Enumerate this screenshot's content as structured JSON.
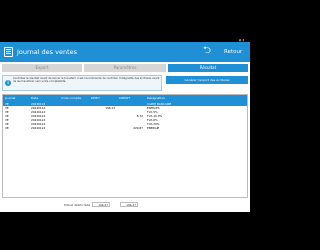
{
  "app": {
    "title": "Journal des ventes",
    "back_label": "Retour",
    "back_icon": "back-arrow-icon"
  },
  "tabs": [
    {
      "label": "Export",
      "active": false
    },
    {
      "label": "Paramètres",
      "active": false
    },
    {
      "label": "Résultat",
      "active": true
    }
  ],
  "info": {
    "text": "Contrôlez le résultat avant de lancer le transfert. Il est recommandé de contrôler l'intégralité des écritures avant de les transférer vers votre comptabilité."
  },
  "export_button": {
    "label": "Générer l'export des écritures"
  },
  "columns": [
    "Journal",
    "Date",
    "Code compte",
    "DEBIT",
    "CREDIT",
    "Désignation"
  ],
  "rows": [
    {
      "journal": "VE",
      "date": "20240124",
      "code": "",
      "debit": "",
      "credit": "",
      "label": "CARTE BANCAIRE",
      "selected": true
    },
    {
      "journal": "VE",
      "date": "20240124",
      "code": "",
      "debit": "196,13",
      "credit": "",
      "label": "ESPECES",
      "selected": false
    },
    {
      "journal": "VE",
      "date": "20240124",
      "code": "",
      "debit": "",
      "credit": "",
      "label": "TVA 5%",
      "selected": false
    },
    {
      "journal": "VE",
      "date": "20240124",
      "code": "",
      "debit": "",
      "credit": "8,70",
      "label": "TVA 10.0%",
      "selected": false
    },
    {
      "journal": "VE",
      "date": "20240124",
      "code": "",
      "debit": "",
      "credit": "",
      "label": "TVA 6%",
      "selected": false
    },
    {
      "journal": "VE",
      "date": "20240124",
      "code": "",
      "debit": "",
      "credit": "",
      "label": "TVA 20%",
      "selected": false
    },
    {
      "journal": "VE",
      "date": "20240124",
      "code": "",
      "debit": "",
      "credit": "229,87",
      "label": "ENERGIE",
      "selected": false
    }
  ],
  "totals": {
    "label": "Totaux débit/crédit",
    "debit": "196,47",
    "credit": "196,47"
  },
  "colors": {
    "accent": "#1f8fd6"
  }
}
